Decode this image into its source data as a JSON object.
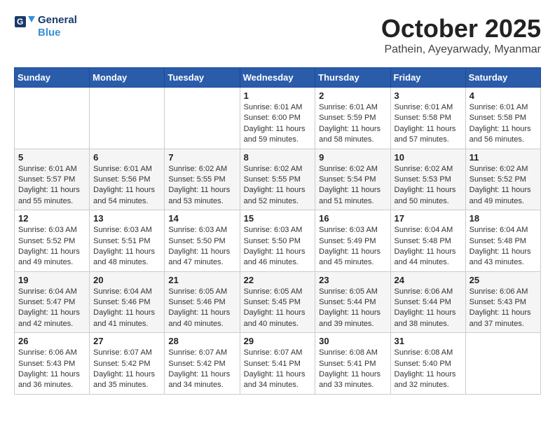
{
  "logo": {
    "line1": "General",
    "line2": "Blue"
  },
  "title": "October 2025",
  "subtitle": "Pathein, Ayeyarwady, Myanmar",
  "weekdays": [
    "Sunday",
    "Monday",
    "Tuesday",
    "Wednesday",
    "Thursday",
    "Friday",
    "Saturday"
  ],
  "weeks": [
    [
      null,
      null,
      null,
      {
        "day": 1,
        "sunrise": "6:01 AM",
        "sunset": "6:00 PM",
        "daylight": "11 hours and 59 minutes."
      },
      {
        "day": 2,
        "sunrise": "6:01 AM",
        "sunset": "5:59 PM",
        "daylight": "11 hours and 58 minutes."
      },
      {
        "day": 3,
        "sunrise": "6:01 AM",
        "sunset": "5:58 PM",
        "daylight": "11 hours and 57 minutes."
      },
      {
        "day": 4,
        "sunrise": "6:01 AM",
        "sunset": "5:58 PM",
        "daylight": "11 hours and 56 minutes."
      }
    ],
    [
      {
        "day": 5,
        "sunrise": "6:01 AM",
        "sunset": "5:57 PM",
        "daylight": "11 hours and 55 minutes."
      },
      {
        "day": 6,
        "sunrise": "6:01 AM",
        "sunset": "5:56 PM",
        "daylight": "11 hours and 54 minutes."
      },
      {
        "day": 7,
        "sunrise": "6:02 AM",
        "sunset": "5:55 PM",
        "daylight": "11 hours and 53 minutes."
      },
      {
        "day": 8,
        "sunrise": "6:02 AM",
        "sunset": "5:55 PM",
        "daylight": "11 hours and 52 minutes."
      },
      {
        "day": 9,
        "sunrise": "6:02 AM",
        "sunset": "5:54 PM",
        "daylight": "11 hours and 51 minutes."
      },
      {
        "day": 10,
        "sunrise": "6:02 AM",
        "sunset": "5:53 PM",
        "daylight": "11 hours and 50 minutes."
      },
      {
        "day": 11,
        "sunrise": "6:02 AM",
        "sunset": "5:52 PM",
        "daylight": "11 hours and 49 minutes."
      }
    ],
    [
      {
        "day": 12,
        "sunrise": "6:03 AM",
        "sunset": "5:52 PM",
        "daylight": "11 hours and 49 minutes."
      },
      {
        "day": 13,
        "sunrise": "6:03 AM",
        "sunset": "5:51 PM",
        "daylight": "11 hours and 48 minutes."
      },
      {
        "day": 14,
        "sunrise": "6:03 AM",
        "sunset": "5:50 PM",
        "daylight": "11 hours and 47 minutes."
      },
      {
        "day": 15,
        "sunrise": "6:03 AM",
        "sunset": "5:50 PM",
        "daylight": "11 hours and 46 minutes."
      },
      {
        "day": 16,
        "sunrise": "6:03 AM",
        "sunset": "5:49 PM",
        "daylight": "11 hours and 45 minutes."
      },
      {
        "day": 17,
        "sunrise": "6:04 AM",
        "sunset": "5:48 PM",
        "daylight": "11 hours and 44 minutes."
      },
      {
        "day": 18,
        "sunrise": "6:04 AM",
        "sunset": "5:48 PM",
        "daylight": "11 hours and 43 minutes."
      }
    ],
    [
      {
        "day": 19,
        "sunrise": "6:04 AM",
        "sunset": "5:47 PM",
        "daylight": "11 hours and 42 minutes."
      },
      {
        "day": 20,
        "sunrise": "6:04 AM",
        "sunset": "5:46 PM",
        "daylight": "11 hours and 41 minutes."
      },
      {
        "day": 21,
        "sunrise": "6:05 AM",
        "sunset": "5:46 PM",
        "daylight": "11 hours and 40 minutes."
      },
      {
        "day": 22,
        "sunrise": "6:05 AM",
        "sunset": "5:45 PM",
        "daylight": "11 hours and 40 minutes."
      },
      {
        "day": 23,
        "sunrise": "6:05 AM",
        "sunset": "5:44 PM",
        "daylight": "11 hours and 39 minutes."
      },
      {
        "day": 24,
        "sunrise": "6:06 AM",
        "sunset": "5:44 PM",
        "daylight": "11 hours and 38 minutes."
      },
      {
        "day": 25,
        "sunrise": "6:06 AM",
        "sunset": "5:43 PM",
        "daylight": "11 hours and 37 minutes."
      }
    ],
    [
      {
        "day": 26,
        "sunrise": "6:06 AM",
        "sunset": "5:43 PM",
        "daylight": "11 hours and 36 minutes."
      },
      {
        "day": 27,
        "sunrise": "6:07 AM",
        "sunset": "5:42 PM",
        "daylight": "11 hours and 35 minutes."
      },
      {
        "day": 28,
        "sunrise": "6:07 AM",
        "sunset": "5:42 PM",
        "daylight": "11 hours and 34 minutes."
      },
      {
        "day": 29,
        "sunrise": "6:07 AM",
        "sunset": "5:41 PM",
        "daylight": "11 hours and 34 minutes."
      },
      {
        "day": 30,
        "sunrise": "6:08 AM",
        "sunset": "5:41 PM",
        "daylight": "11 hours and 33 minutes."
      },
      {
        "day": 31,
        "sunrise": "6:08 AM",
        "sunset": "5:40 PM",
        "daylight": "11 hours and 32 minutes."
      },
      null
    ]
  ]
}
